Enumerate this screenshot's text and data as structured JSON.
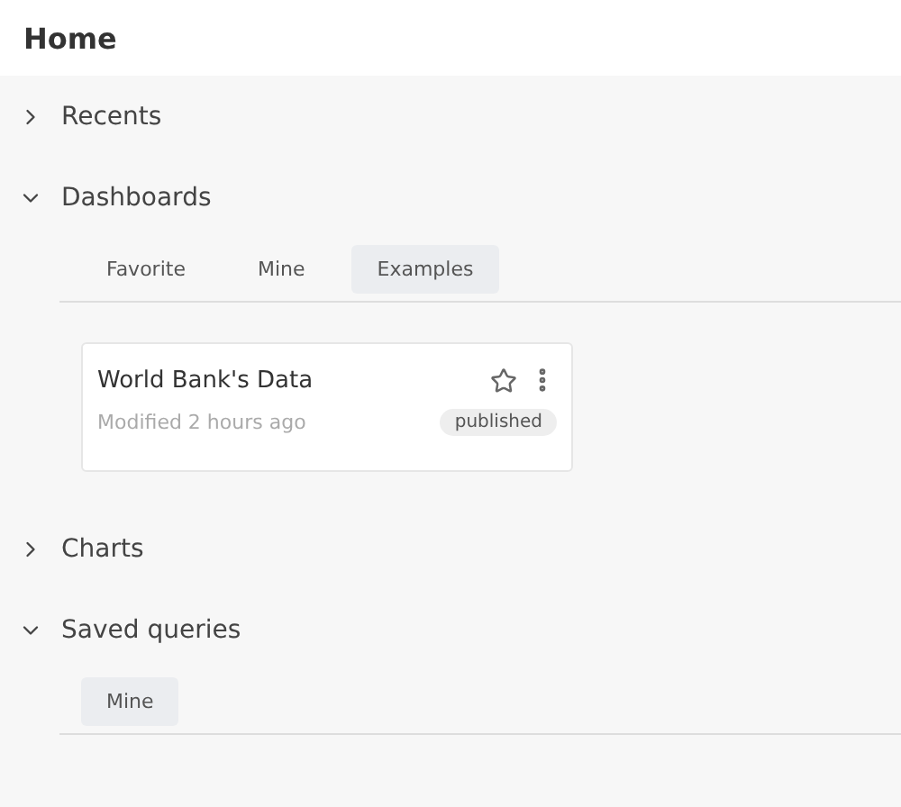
{
  "header": {
    "title": "Home"
  },
  "sections": [
    {
      "title": "Recents",
      "expanded": false
    },
    {
      "title": "Dashboards",
      "expanded": true,
      "tabs": [
        {
          "label": "Favorite",
          "selected": false
        },
        {
          "label": "Mine",
          "selected": false
        },
        {
          "label": "Examples",
          "selected": true
        }
      ],
      "cards": [
        {
          "title": "World Bank's Data",
          "modified": "Modified 2 hours ago",
          "status": "published",
          "starred": false
        }
      ]
    },
    {
      "title": "Charts",
      "expanded": false
    },
    {
      "title": "Saved queries",
      "expanded": true,
      "tabs": [
        {
          "label": "Mine",
          "selected": true
        }
      ]
    }
  ]
}
